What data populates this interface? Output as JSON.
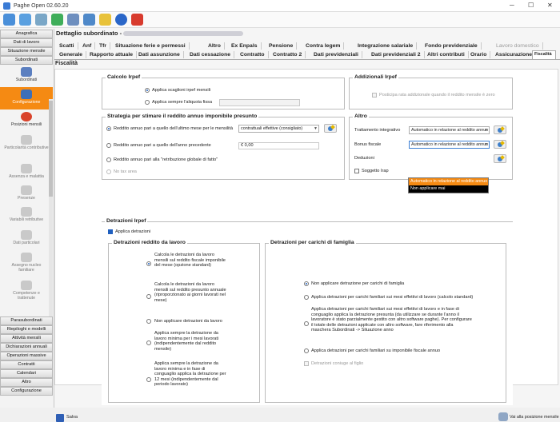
{
  "window": {
    "title": "Paghe Open 02.60.20",
    "controls": {
      "minimize": "─",
      "maximize": "☐",
      "close": "✕"
    }
  },
  "sidebar": {
    "top_groups": [
      "Anagrafica",
      "Dati di lavoro",
      "Situazione mensile",
      "Subordinati"
    ],
    "items": [
      "Subordinati",
      "Configurazione",
      "Posizioni mensili",
      "Particolarità contributive",
      "Assenza e malattia",
      "Presenze",
      "Variabili retributive",
      "Dati particolari",
      "Assegno nucleo familiare",
      "Competenze e trattenute"
    ],
    "bottom_groups": [
      "Parasubordinati",
      "Riepiloghi e modelli",
      "Attività mensili",
      "Dichiarazioni annuali",
      "Operazioni massive",
      "Contratti",
      "Calendari",
      "Altro",
      "Configurazione"
    ]
  },
  "header": {
    "title": "Dettaglio subordinato -"
  },
  "tabs_row1": [
    "Scatti",
    "Anf",
    "Tfr",
    "Situazione ferie e permessi",
    "Altro",
    "Ex Enpals",
    "Pensione",
    "Contra legem",
    "Integrazione salariale",
    "Fondo previdenziale",
    "Lavoro domestico"
  ],
  "tabs_row2": [
    "Generale",
    "Rapporto attuale",
    "Dati assunzione",
    "Dati cessazione",
    "Contratto",
    "Contratto 2",
    "Dati previdenziali",
    "Dati previdenziali 2",
    "Altri contributi",
    "Orario",
    "Assicurazione",
    "Fiscalità"
  ],
  "section_title": "Fiscalità",
  "calcolo": {
    "title": "Calcolo Irpef",
    "opt1": "Applica scaglioni irpef mensili",
    "opt2": "Applica sempre l'aliquota fissa"
  },
  "addizionali": {
    "title": "Addizionali Irpef",
    "chk": "Posticipa rata addizionale quando il reddito mensile è zero"
  },
  "strategia": {
    "title": "Strategia per stimare il reddito annuo imponibile presunto",
    "opt1": "Reddito annuo pari a quello dell'ultimo mese per le mensilità",
    "opt1_select": "contrattuali effettive (consigliato)",
    "opt2": "Reddito annuo pari a quello dell'anno precedente",
    "opt2_value": "€ 0,00",
    "opt3": "Reddito annuo pari alla \"retribuzione globale di fatto\"",
    "opt4": "No tax area"
  },
  "altro": {
    "title": "Altro",
    "trattamento_label": "Trattamento integrativo",
    "trattamento_value": "Automatico in relazione al reddito annuo",
    "bonus_label": "Bonus fiscale",
    "bonus_value": "Automatico in relazione al reddito annuo",
    "bonus_options": [
      "Automatico in relazione al reddito annuo",
      "Non applicare mai"
    ],
    "deduzioni_label": "Deduzioni",
    "soggetto": "Soggetto Irap"
  },
  "detrazioni": {
    "title": "Detrazioni Irpef",
    "applica": "Applica detrazioni"
  },
  "lavoro": {
    "title": "Detrazioni reddito da lavoro",
    "opts": [
      "Calcola le detrazioni da lavoro mensili sul reddito fiscale imponibile del mese (opzione standard)",
      "Calcola le detrazioni da lavoro mensili sul reddito presunto annuale (riproporzionato ai giorni lavorati nel mese)",
      "Non applicare detrazioni da lavoro",
      "Applica sempre la detrazione da lavoro minima per i mesi lavorati (indipendentemente dal reddito mensile)",
      "Applica sempre la detrazione da lavoro minima e in fase di conguaglio applica la detrazione per 12 mesi (indipendentemente dal periodo lavorato)"
    ]
  },
  "familiari": {
    "title": "Detrazioni per carichi di famiglia",
    "opts": [
      "Non applicare detrazione per carichi di famiglia",
      "Applica detrazioni per carichi familiari sui mesi effettivi di lavoro (calcolo standard)",
      "Applica detrazioni per carichi familiari sui mesi effettivi di lavoro e in fase di conguaglio applica la detrazione presunta (da utilizzare se durante l'anno il lavoratore è stato parzialmente gestito con altro software paghe). Per configurare il totale delle detrazioni applicate con altro software, fare riferimento alla maschera Subordinati -> Situazione anno",
      "Applica detrazioni per carichi familiari su imponibile fiscale annuo"
    ],
    "coniuge": "Detrazioni coniuge al figlio"
  },
  "footer": {
    "save": "Salva",
    "goto": "Vai alla posizione mensile"
  }
}
